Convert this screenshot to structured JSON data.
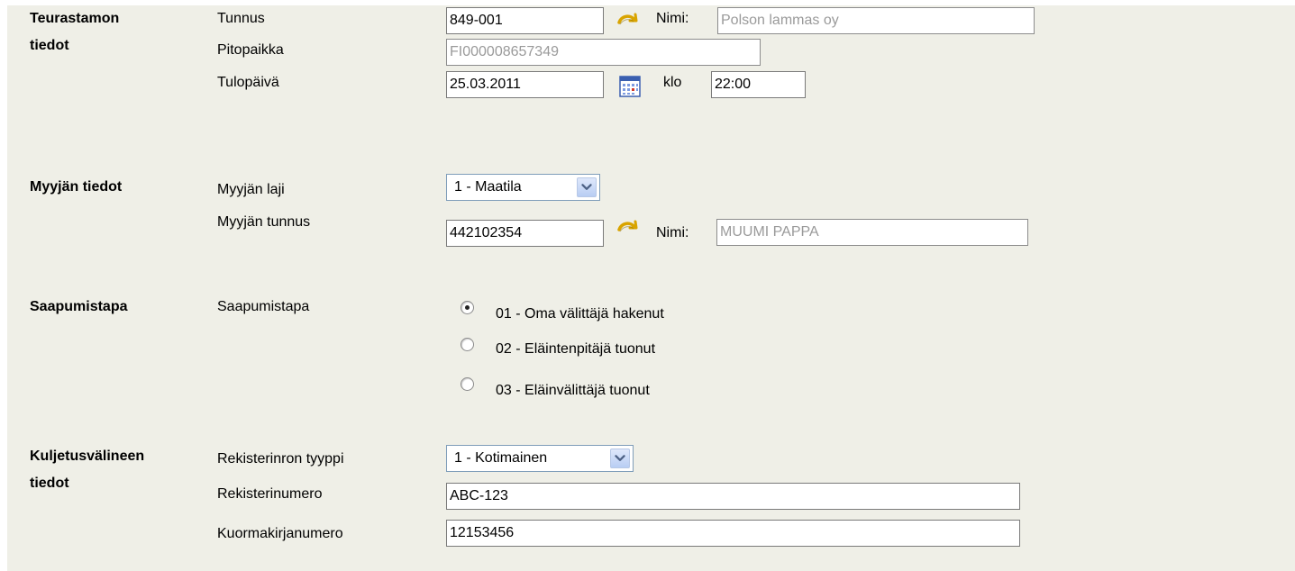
{
  "sections": {
    "teurastamo": {
      "title_line1": "Teurastamon",
      "title_line2": "tiedot",
      "tunnus_label": "Tunnus",
      "tunnus_value": "849-001",
      "nimi_label": "Nimi:",
      "nimi_value": "Polson lammas oy",
      "pitopaikka_label": "Pitopaikka",
      "pitopaikka_value": "FI000008657349",
      "tulopaiva_label": "Tulopäivä",
      "tulopaiva_value": "25.03.2011",
      "klo_label": "klo",
      "klo_value": "22:00"
    },
    "myyja": {
      "title": "Myyjän tiedot",
      "laji_label": "Myyjän laji",
      "laji_value": "1 - Maatila",
      "tunnus_label": "Myyjän tunnus",
      "tunnus_value": "442102354",
      "nimi_label": "Nimi:",
      "nimi_value": "MUUMI PAPPA"
    },
    "saapumistapa": {
      "title": "Saapumistapa",
      "label": "Saapumistapa",
      "options": [
        {
          "label": "01 - Oma välittäjä hakenut",
          "selected": true
        },
        {
          "label": "02 - Eläintenpitäjä tuonut",
          "selected": false
        },
        {
          "label": "03 - Eläinvälittäjä tuonut",
          "selected": false
        }
      ]
    },
    "kuljetus": {
      "title_line1": "Kuljetusvälineen",
      "title_line2": "tiedot",
      "tyyppi_label": "Rekisterinron tyyppi",
      "tyyppi_value": "1 - Kotimainen",
      "rekisterinumero_label": "Rekisterinumero",
      "rekisterinumero_value": "ABC-123",
      "kuormakirja_label": "Kuormakirjanumero",
      "kuormakirja_value": "12153456"
    }
  },
  "colors": {
    "panel_bg": "#efefe7",
    "lookup_arrow": "#d9a400",
    "select_border": "#7f9db9",
    "readonly_text": "#9a9a9a"
  },
  "icons": {
    "lookup": "lookup-arrow-icon",
    "calendar": "calendar-icon",
    "dropdown": "chevron-down-icon"
  }
}
